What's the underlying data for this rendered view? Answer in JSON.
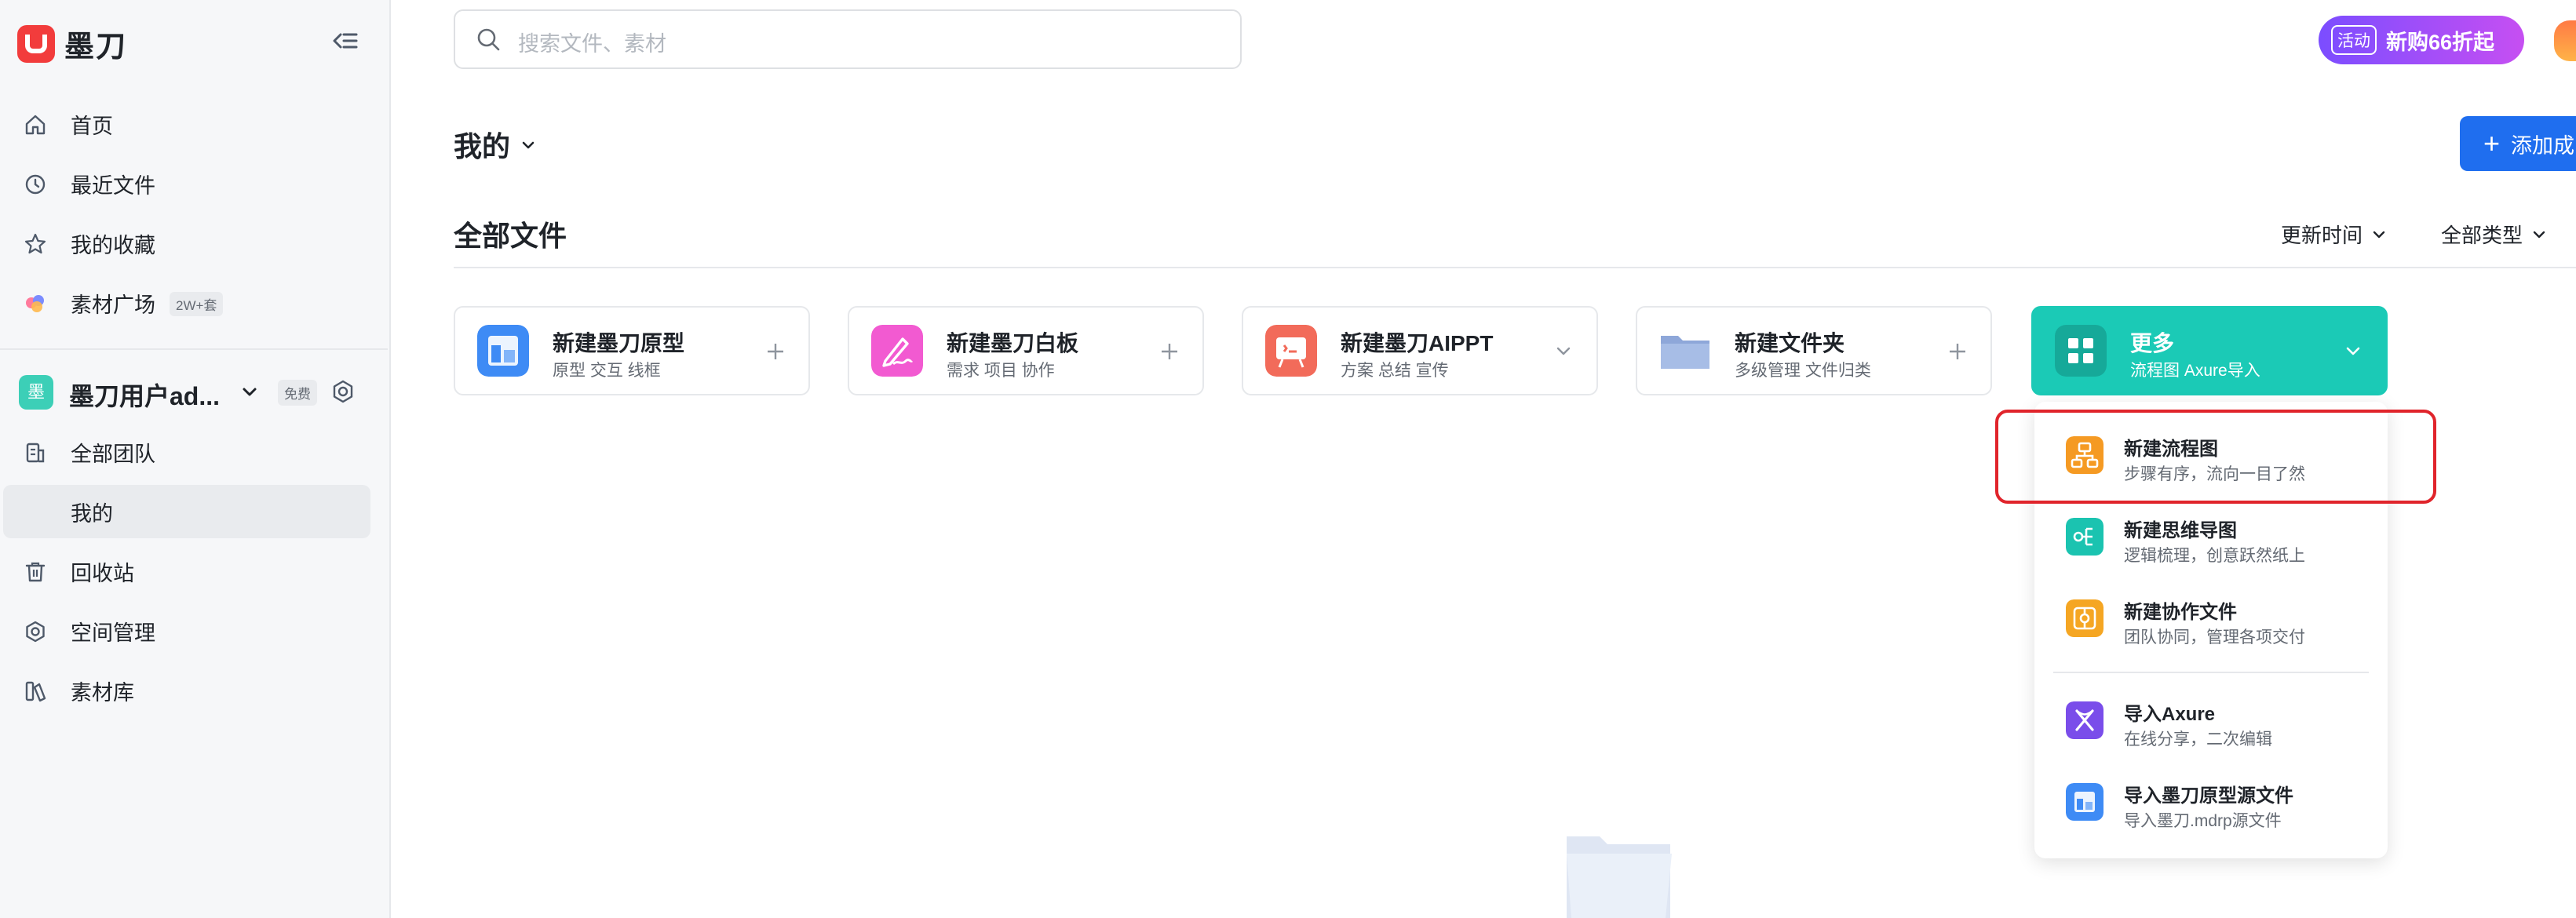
{
  "app": {
    "name": "墨刀"
  },
  "search": {
    "placeholder": "搜索文件、素材"
  },
  "promo": {
    "tag": "活动",
    "text": "新购66折起"
  },
  "sidebar": {
    "items": [
      {
        "label": "首页"
      },
      {
        "label": "最近文件"
      },
      {
        "label": "我的收藏"
      },
      {
        "label": "素材广场",
        "badge": "2W+套"
      }
    ],
    "team": {
      "avatar": "墨",
      "name": "墨刀用户ad...",
      "plan": "免费"
    },
    "team_items": [
      {
        "label": "全部团队"
      },
      {
        "label": "我的"
      },
      {
        "label": "回收站"
      },
      {
        "label": "空间管理"
      },
      {
        "label": "素材库"
      }
    ]
  },
  "main": {
    "title": "我的",
    "add_button": "添加成",
    "section_title": "全部文件",
    "sort_time": "更新时间",
    "sort_type": "全部类型",
    "cards": [
      {
        "title": "新建墨刀原型",
        "subtitle": "原型 交互 线框"
      },
      {
        "title": "新建墨刀白板",
        "subtitle": "需求 项目 协作"
      },
      {
        "title": "新建墨刀AIPPT",
        "subtitle": "方案 总结 宣传"
      },
      {
        "title": "新建文件夹",
        "subtitle": "多级管理 文件归类"
      },
      {
        "title": "更多",
        "subtitle": "流程图 Axure导入"
      }
    ]
  },
  "dropdown": {
    "items": [
      {
        "title": "新建流程图",
        "subtitle": "步骤有序，流向一目了然"
      },
      {
        "title": "新建思维导图",
        "subtitle": "逻辑梳理，创意跃然纸上"
      },
      {
        "title": "新建协作文件",
        "subtitle": "团队协同，管理各项交付"
      },
      {
        "title": "导入Axure",
        "subtitle": "在线分享，二次编辑"
      },
      {
        "title": "导入墨刀原型源文件",
        "subtitle": "导入墨刀.mdrp源文件"
      }
    ]
  },
  "colors": {
    "brand_red": "#f23c3c",
    "primary_blue": "#1f6eef",
    "more_teal": "#1bcab6",
    "highlight_red": "#e0242b"
  }
}
